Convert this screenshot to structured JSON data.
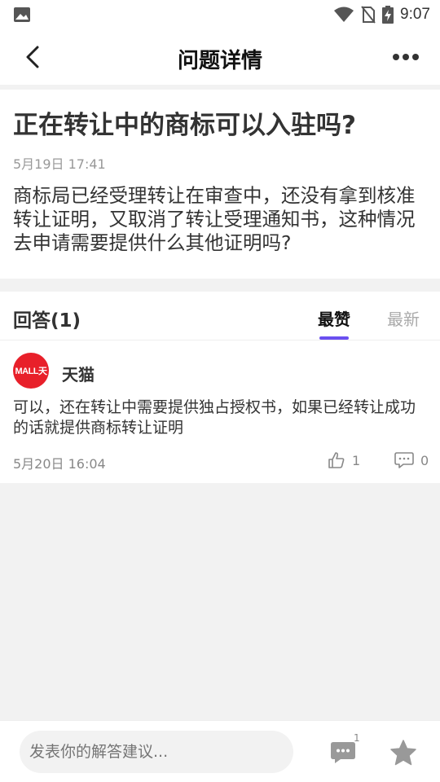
{
  "status_bar": {
    "time": "9:07",
    "icons": [
      "image-icon",
      "wifi-icon",
      "no-sim-icon",
      "battery-charging-icon"
    ]
  },
  "app_bar": {
    "title": "问题详情",
    "back_icon": "chevron-left-icon",
    "more_icon": "more-horizontal-icon"
  },
  "question": {
    "title": "正在转让中的商标可以入驻吗?",
    "time": "5月19日 17:41",
    "body": "商标局已经受理转让在审查中，还没有拿到核准转让证明，又取消了转让受理通知书，这种情况去申请需要提供什么其他证明吗?"
  },
  "answers": {
    "heading": "回答(1)",
    "tabs": [
      {
        "label": "最赞",
        "active": true
      },
      {
        "label": "最新",
        "active": false
      }
    ],
    "accent_color": "#6a4ff0",
    "items": [
      {
        "avatar_text": "MALL天",
        "avatar_color": "#e8202a",
        "author": "天猫",
        "body": "可以，还在转让中需要提供独占授权书，如果已经转让成功的话就提供商标转让证明",
        "time": "5月20日 16:04",
        "likes": "1",
        "comments": "0"
      }
    ]
  },
  "bottom_bar": {
    "input_placeholder": "发表你的解答建议...",
    "comment_count": "1",
    "chat_icon": "chat-icon",
    "star_icon": "star-icon"
  }
}
